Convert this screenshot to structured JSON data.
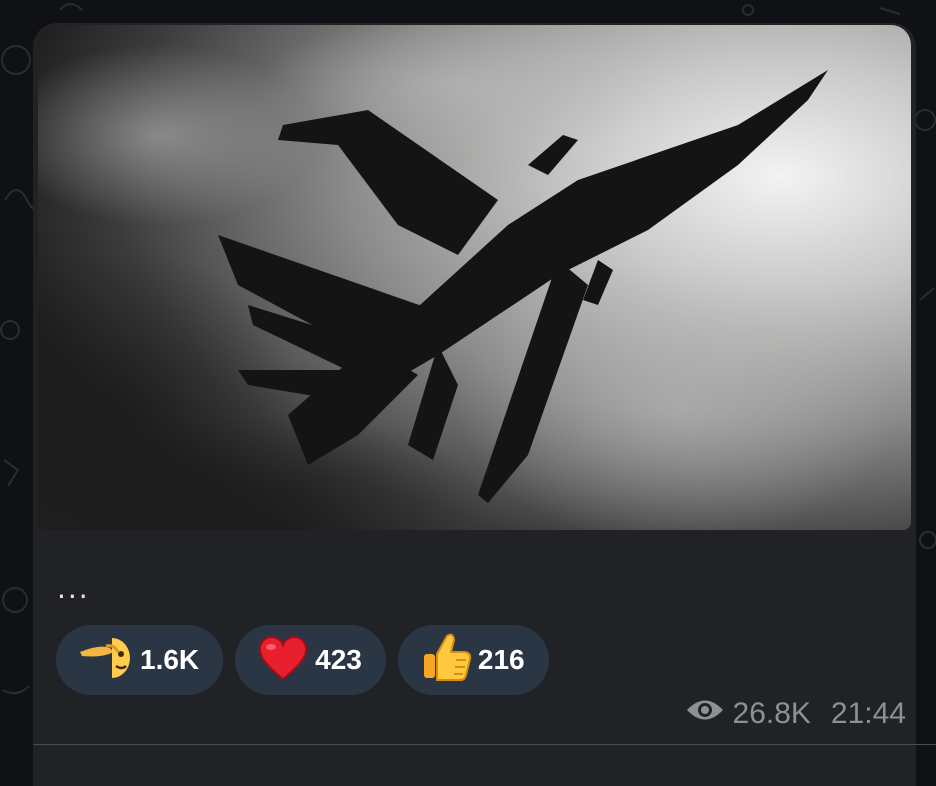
{
  "message": {
    "caption": "...",
    "photo_icon": "jet-silhouette-photo",
    "reactions": [
      {
        "icon": "saluting-face-emoji",
        "count": "1.6K"
      },
      {
        "icon": "red-heart-emoji",
        "count": "423"
      },
      {
        "icon": "thumbs-up-emoji",
        "count": "216"
      }
    ],
    "views": "26.8K",
    "time": "21:44"
  },
  "colors": {
    "bubble": "#212225",
    "reaction_pill": "#2b3645",
    "meta_text": "#8d9095",
    "background": "#0f1114"
  }
}
